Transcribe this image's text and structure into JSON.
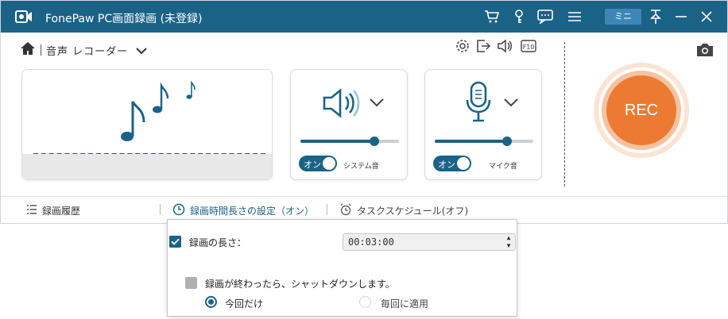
{
  "window": {
    "title": "FonePaw PC画面録画 (未登録)",
    "mini_label": "ミニ"
  },
  "toolbar": {
    "mode_label": "音声 レコーダー"
  },
  "speaker": {
    "volume": 0.75,
    "toggle_label": "オン",
    "caption": "システム音"
  },
  "microphone": {
    "volume": 0.73,
    "toggle_label": "オン",
    "caption": "マイク音"
  },
  "rec_label": "REC",
  "bottom": {
    "history_label": "録画履歴",
    "duration_label": "録画時間長さの設定（オン）",
    "schedule_label": "タスクスケジュール(オフ)"
  },
  "popup": {
    "length_label": "録画の長さ：",
    "length_value": "00:03:00",
    "shutdown_label": "録画が終わったら、シャットダウンします。",
    "radio_once": "今回だけ",
    "radio_every": "毎回に適用"
  },
  "colors": {
    "accent": "#1b6287",
    "rec": "#ed7a32"
  }
}
